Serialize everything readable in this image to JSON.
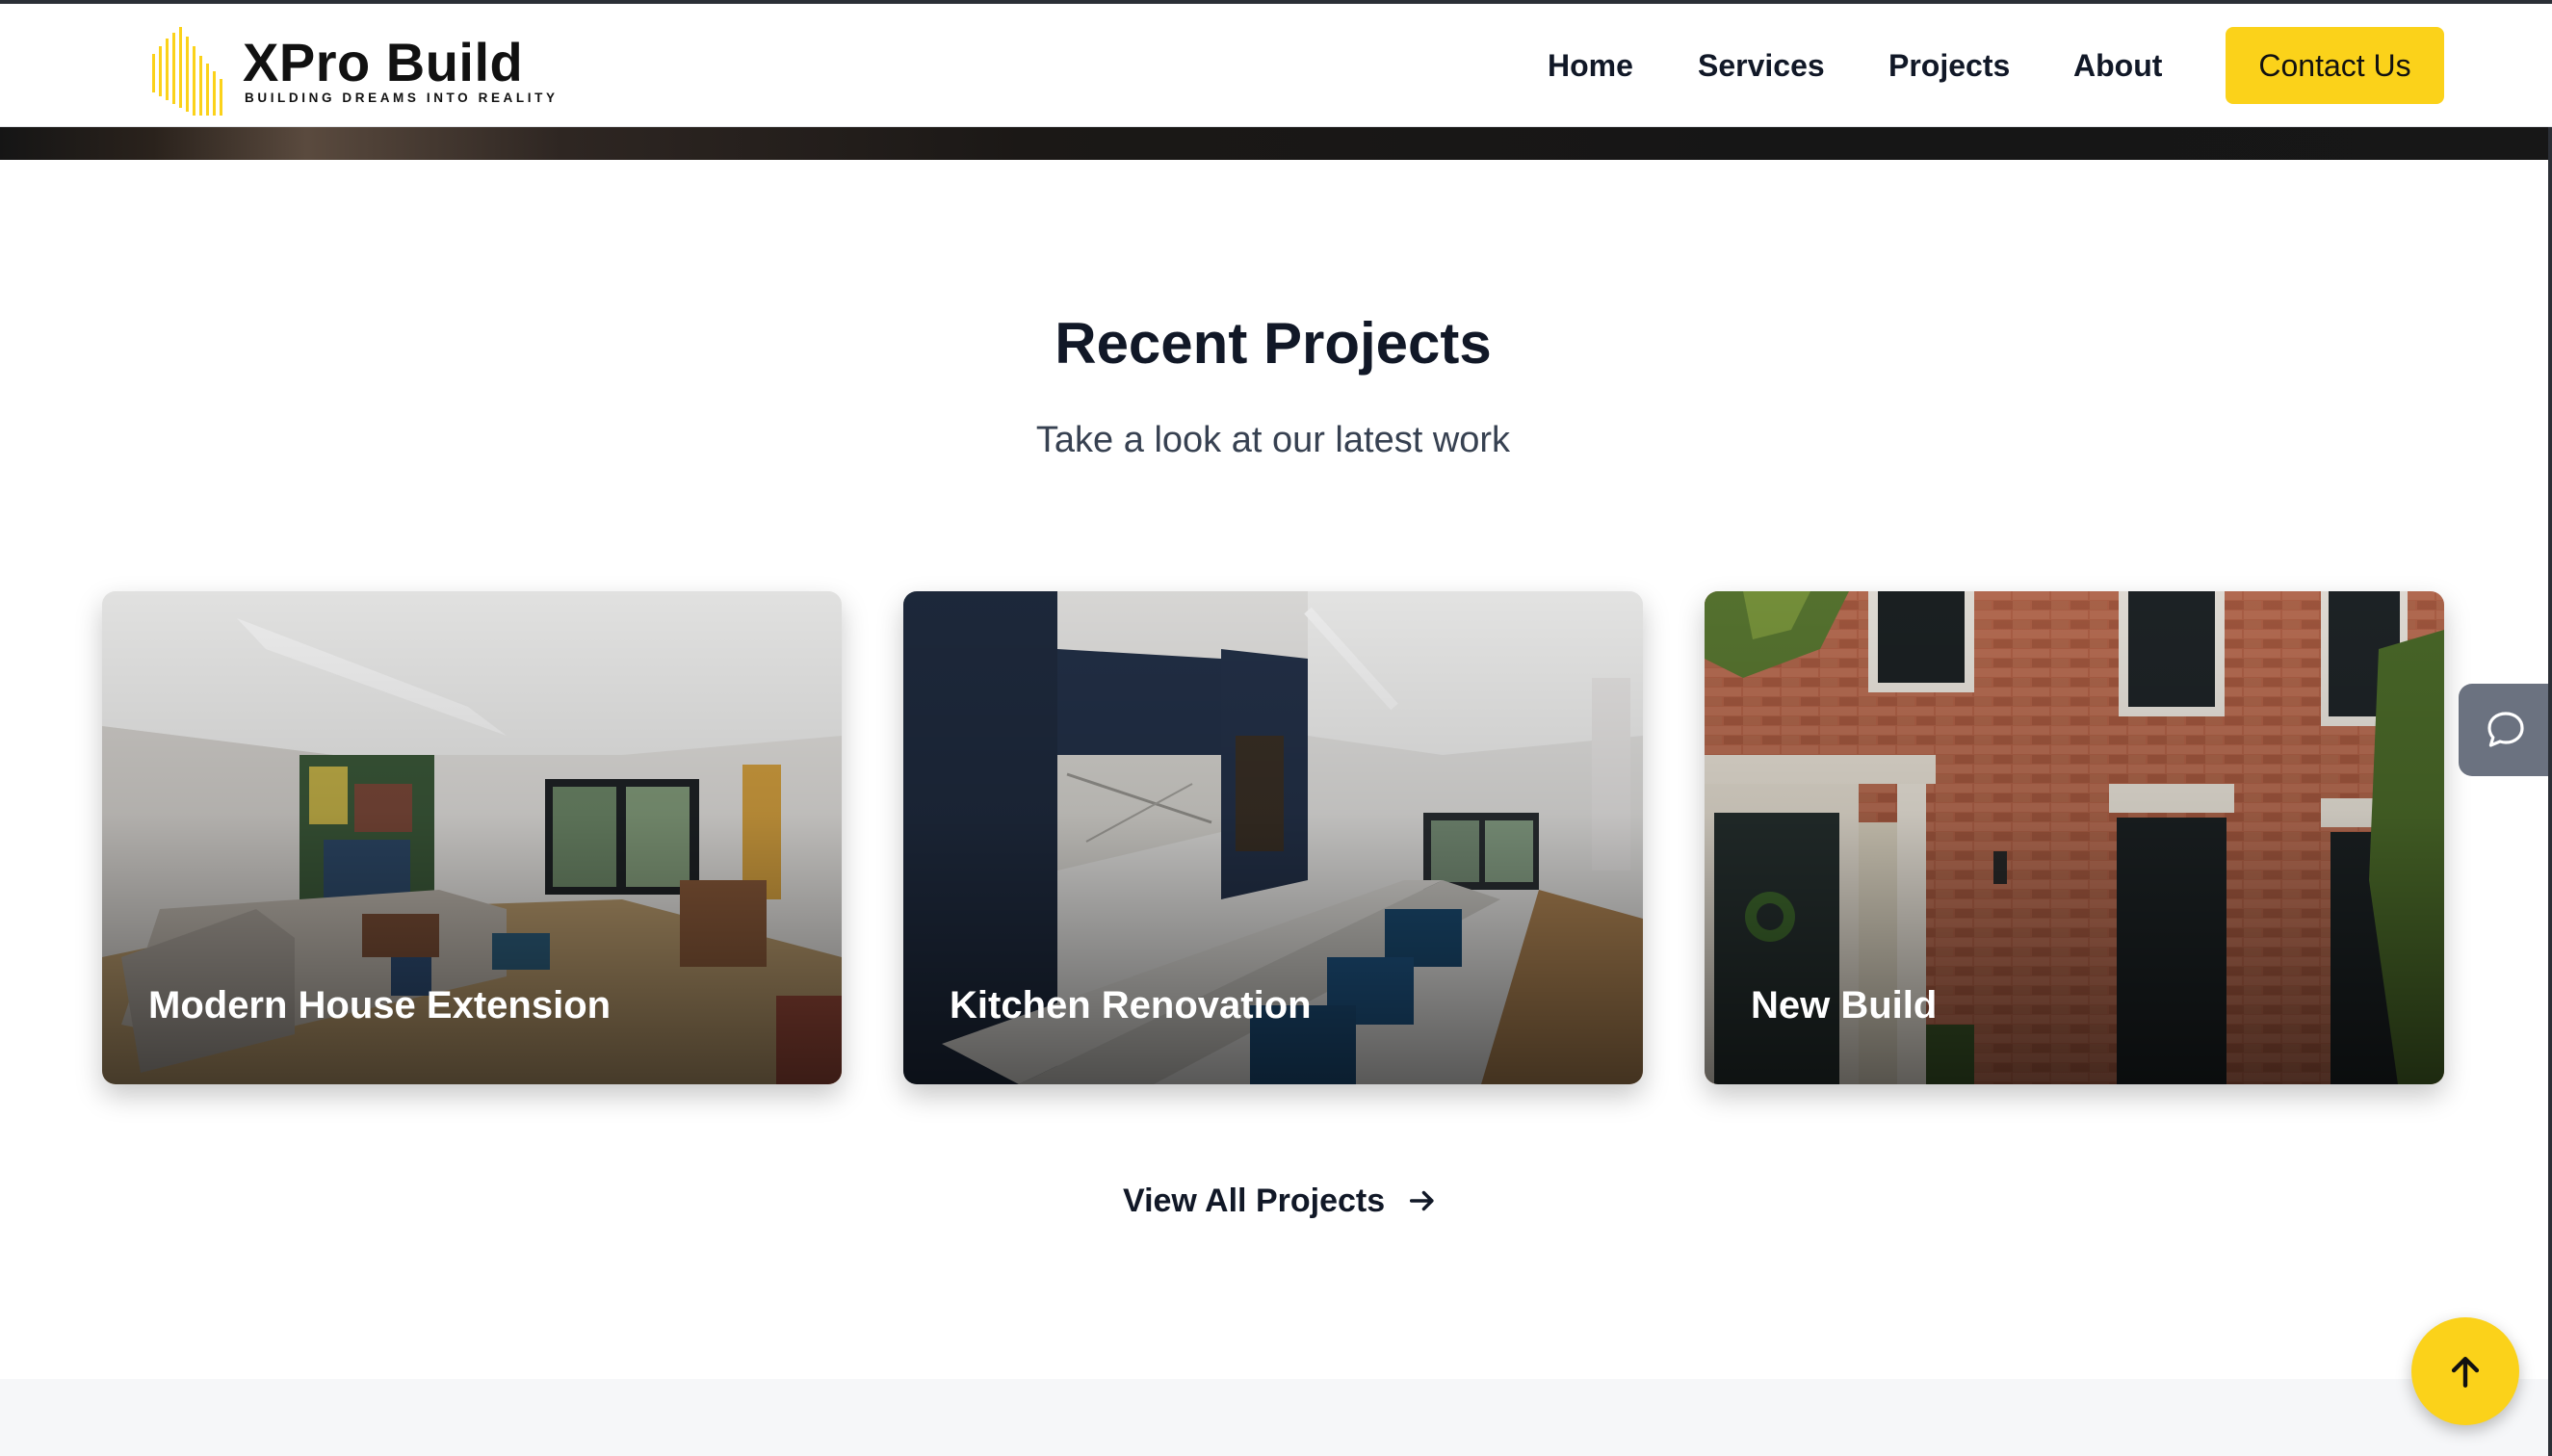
{
  "brand": {
    "name": "XPro Build",
    "tagline": "BUILDING DREAMS INTO REALITY",
    "accent_color": "#fbd21a"
  },
  "nav": {
    "items": [
      {
        "label": "Home"
      },
      {
        "label": "Services"
      },
      {
        "label": "Projects"
      },
      {
        "label": "About"
      }
    ],
    "cta_label": "Contact Us"
  },
  "section": {
    "title": "Recent Projects",
    "subtitle": "Take a look at our latest work"
  },
  "projects": [
    {
      "title": "Modern House Extension",
      "image": "living-room-photo"
    },
    {
      "title": "Kitchen Renovation",
      "image": "kitchen-photo"
    },
    {
      "title": "New Build",
      "image": "brick-house-facade-photo"
    }
  ],
  "view_all": {
    "label": "View All Projects",
    "icon": "arrow-right-icon"
  },
  "chat": {
    "icon": "chat-bubble-icon"
  },
  "scroll_top": {
    "icon": "arrow-up-icon"
  }
}
